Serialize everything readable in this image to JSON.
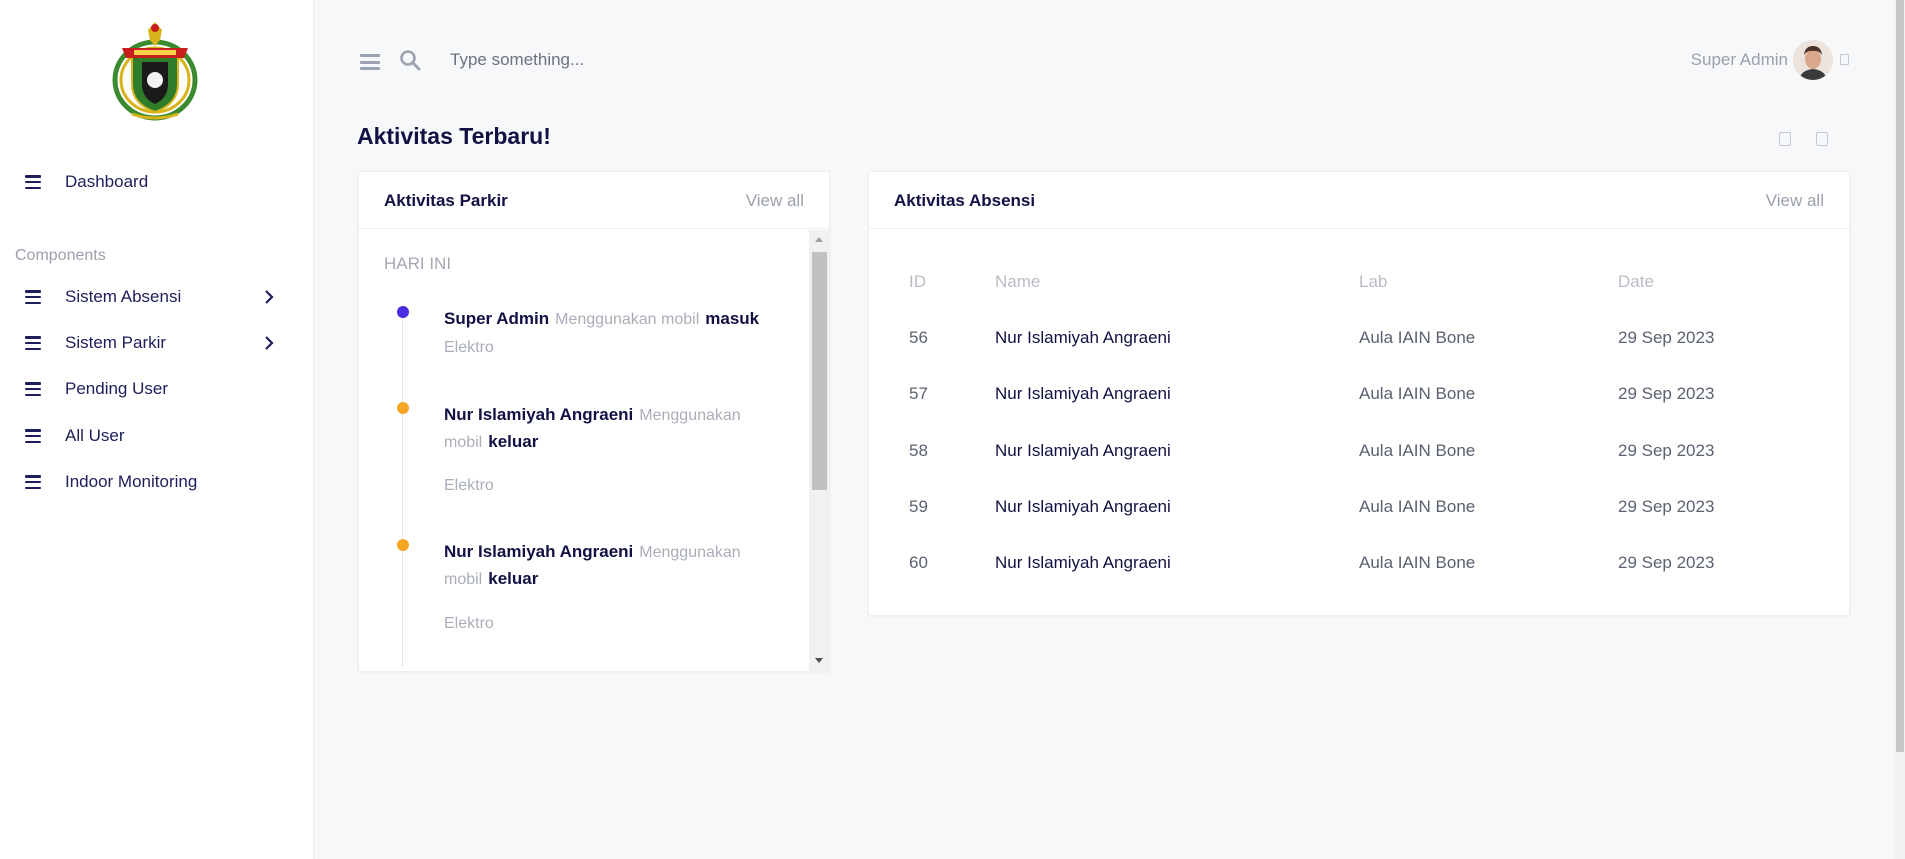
{
  "sidebar": {
    "logo_alt": "logo",
    "items": [
      {
        "label": "Dashboard"
      },
      {
        "label": "Sistem Absensi",
        "has_submenu": true
      },
      {
        "label": "Sistem Parkir",
        "has_submenu": true
      },
      {
        "label": "Pending User"
      },
      {
        "label": "All User"
      },
      {
        "label": "Indoor Monitoring"
      }
    ],
    "section_title": "Components"
  },
  "topbar": {
    "search_placeholder": "Type something...",
    "user_name": "Super Admin"
  },
  "page": {
    "title": "Aktivitas Terbaru!"
  },
  "parkir": {
    "title": "Aktivitas Parkir",
    "view_all": "View all",
    "day_label": "HARI INI",
    "entries": [
      {
        "name": "Super Admin",
        "action": "Menggunakan mobil",
        "direction": "masuk",
        "place": "Elektro",
        "dot_color": "#4a2ee0"
      },
      {
        "name": "Nur Islamiyah Angraeni",
        "action": "Menggunakan mobil",
        "direction": "keluar",
        "place": "Elektro",
        "dot_color": "#f5a623"
      },
      {
        "name": "Nur Islamiyah Angraeni",
        "action": "Menggunakan mobil",
        "direction": "keluar",
        "place": "Elektro",
        "dot_color": "#f5a623"
      }
    ]
  },
  "absensi": {
    "title": "Aktivitas Absensi",
    "view_all": "View all",
    "columns": [
      "ID",
      "Name",
      "Lab",
      "Date"
    ],
    "rows": [
      {
        "id": "56",
        "name": "Nur Islamiyah Angraeni",
        "lab": "Aula IAIN Bone",
        "date": "29 Sep 2023"
      },
      {
        "id": "57",
        "name": "Nur Islamiyah Angraeni",
        "lab": "Aula IAIN Bone",
        "date": "29 Sep 2023"
      },
      {
        "id": "58",
        "name": "Nur Islamiyah Angraeni",
        "lab": "Aula IAIN Bone",
        "date": "29 Sep 2023"
      },
      {
        "id": "59",
        "name": "Nur Islamiyah Angraeni",
        "lab": "Aula IAIN Bone",
        "date": "29 Sep 2023"
      },
      {
        "id": "60",
        "name": "Nur Islamiyah Angraeni",
        "lab": "Aula IAIN Bone",
        "date": "29 Sep 2023"
      }
    ]
  },
  "colors": {
    "accent": "#1e1e5a",
    "dot_primary": "#4a2ee0",
    "dot_warning": "#f5a623"
  }
}
